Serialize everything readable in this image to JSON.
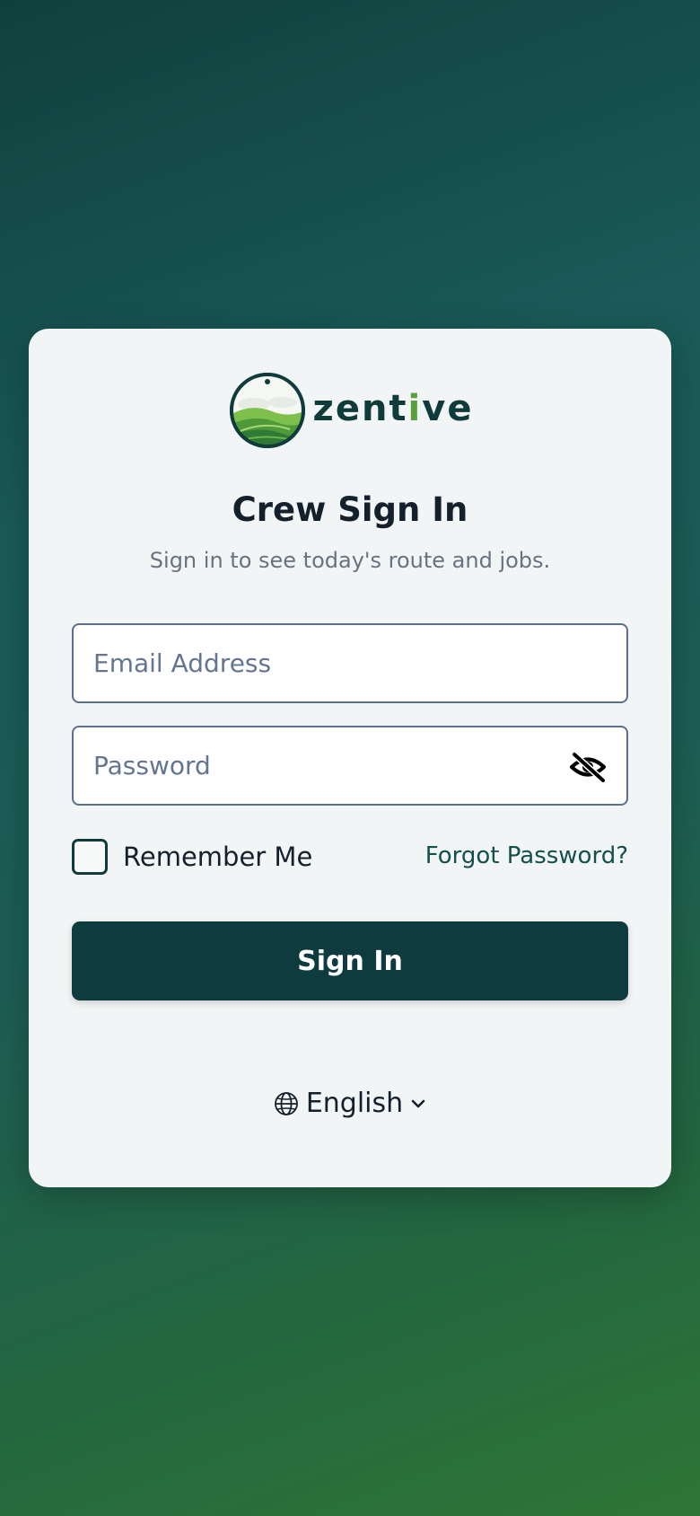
{
  "brand": {
    "name_prefix": "zent",
    "name_i": "i",
    "name_suffix": "ve",
    "logo_icon": "sun-over-green-hills-logo",
    "colors": {
      "dark": "#0f3b3b",
      "accent": "#5aa03c"
    }
  },
  "header": {
    "title": "Crew Sign In",
    "subtitle": "Sign in to see today's route and jobs."
  },
  "form": {
    "email": {
      "placeholder": "Email Address",
      "value": ""
    },
    "password": {
      "placeholder": "Password",
      "value": "",
      "toggle_icon": "eye-slash-icon"
    },
    "remember": {
      "label": "Remember Me",
      "checked": false
    },
    "forgot_label": "Forgot Password?",
    "submit_label": "Sign In"
  },
  "language": {
    "selected": "English",
    "icon": "globe-icon",
    "chevron": "chevron-down-icon"
  },
  "theme": {
    "primary": "#0d3b3e",
    "card_bg": "#f2f5f5",
    "text": "#14202b",
    "muted": "#6a7280",
    "link": "#14504b",
    "field_border": "#5d6f8a"
  }
}
